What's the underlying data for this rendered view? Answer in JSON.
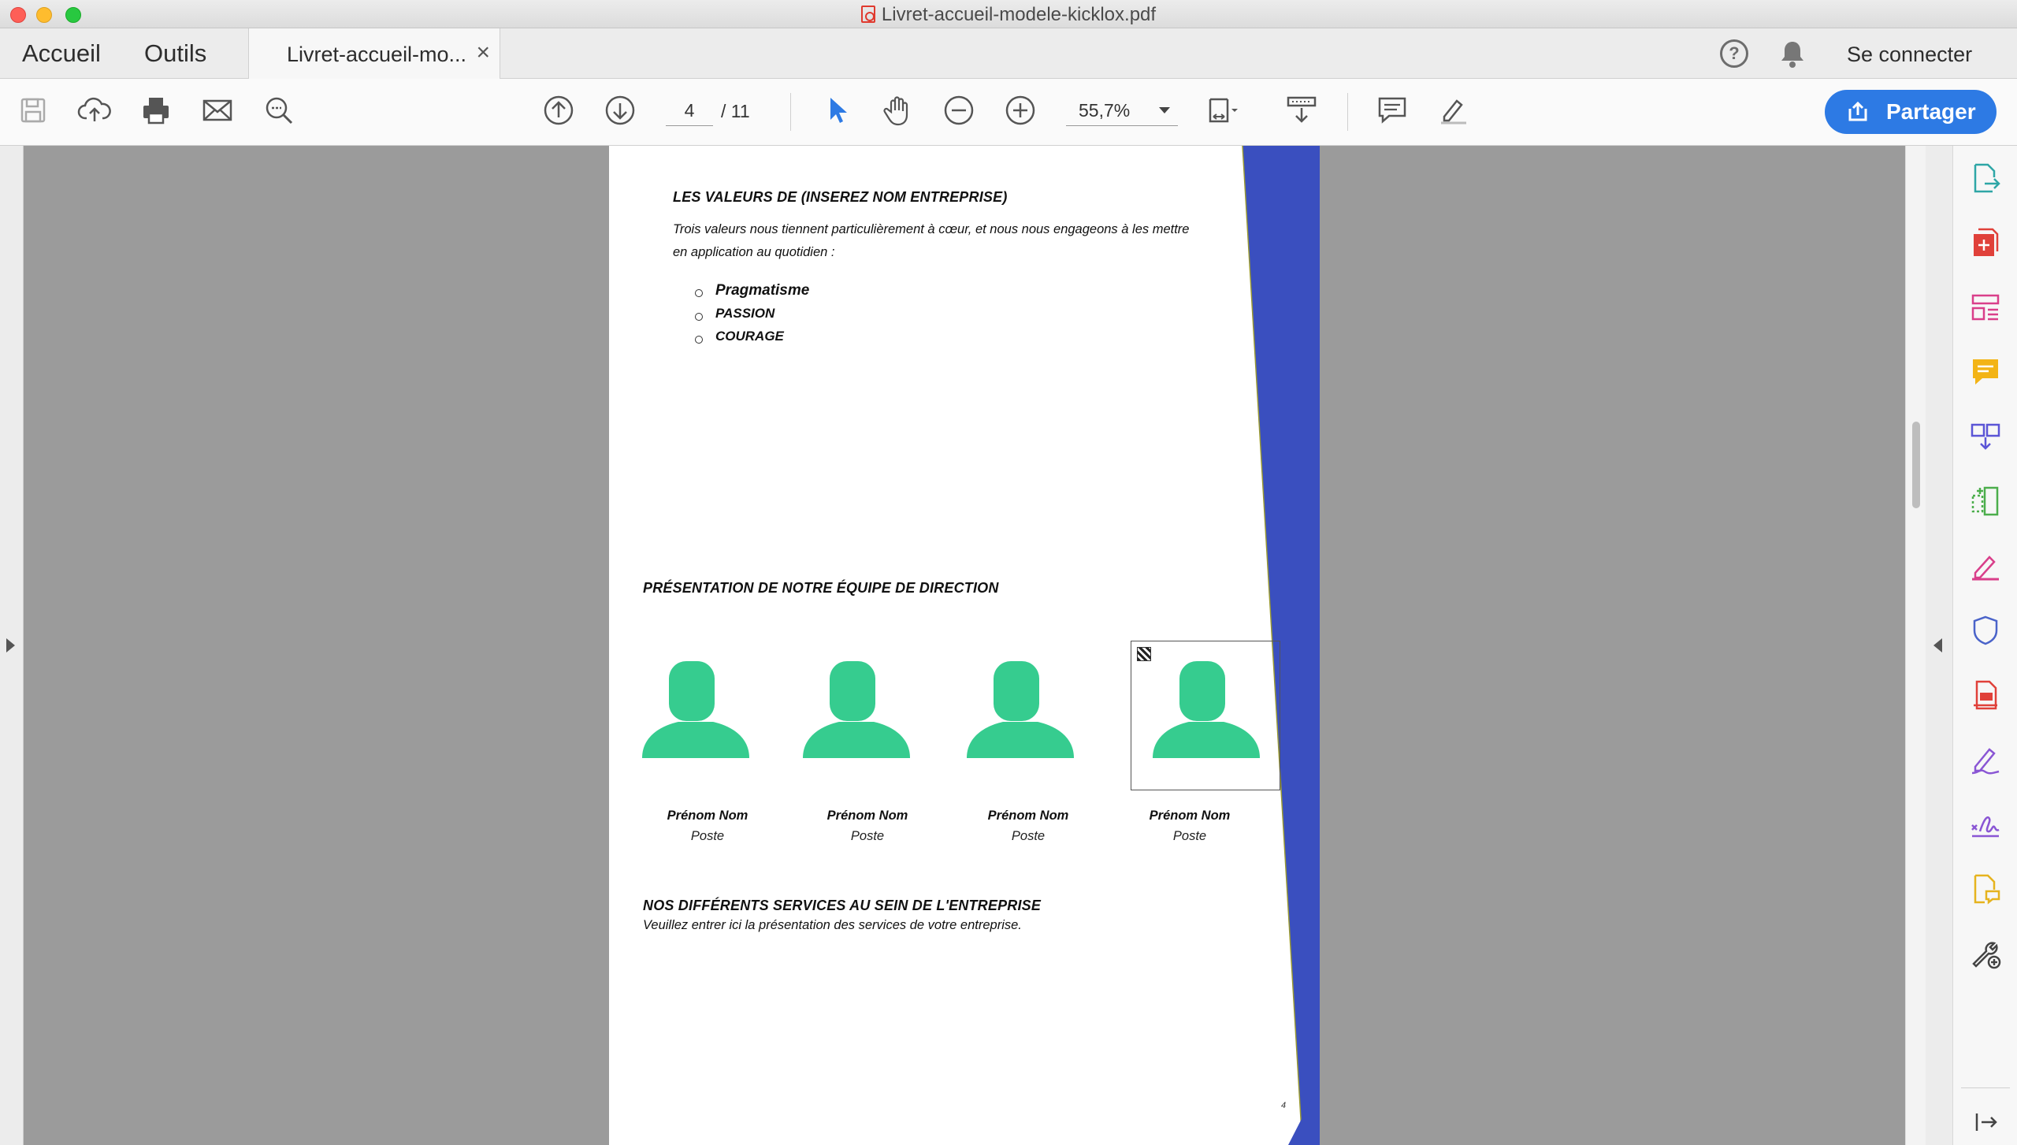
{
  "window": {
    "title": "Livret-accueil-modele-kicklox.pdf"
  },
  "nav": {
    "home": "Accueil",
    "tools": "Outils"
  },
  "tab": {
    "label": "Livret-accueil-mo...",
    "close": "×"
  },
  "header": {
    "help": "?",
    "signin": "Se connecter"
  },
  "toolbar": {
    "page_current": "4",
    "page_total": "/  11",
    "zoom": "55,7%",
    "share_label": "Partager",
    "icons": [
      "save-icon",
      "cloud-upload-icon",
      "print-icon",
      "mail-icon",
      "search-zoom-icon",
      "previous-page-icon",
      "next-page-icon",
      "select-cursor-icon",
      "hand-icon",
      "zoom-out-icon",
      "zoom-in-icon",
      "page-fit-icon",
      "scroll-mode-icon",
      "comment-icon",
      "highlight-icon"
    ]
  },
  "right_panel": {
    "tools": [
      "export-pdf-icon",
      "create-pdf-icon",
      "organize-pages-icon",
      "comment-tool-icon",
      "combine-files-icon",
      "compress-icon",
      "edit-pdf-icon",
      "protect-icon",
      "prepare-form-icon",
      "fill-sign-icon",
      "request-signature-icon",
      "send-for-comments-icon",
      "more-tools-icon",
      "collapse-panel-icon"
    ]
  },
  "document": {
    "values_heading": "LES VALEURS DE (INSEREZ NOM ENTREPRISE)",
    "values_intro_line1": "Trois valeurs nous tiennent particulièrement à cœur, et nous nous engageons à les mettre",
    "values_intro_line2": "en application au quotidien :",
    "values": [
      "Pragmatisme",
      "PASSION",
      "COURAGE"
    ],
    "team_heading": "PRÉSENTATION DE NOTRE ÉQUIPE DE DIRECTION",
    "team": [
      {
        "name": "Prénom Nom",
        "role": "Poste"
      },
      {
        "name": "Prénom Nom",
        "role": "Poste"
      },
      {
        "name": "Prénom Nom",
        "role": "Poste"
      },
      {
        "name": "Prénom Nom",
        "role": "Poste"
      }
    ],
    "services_heading": "NOS DIFFÉRENTS SERVICES AU SEIN DE L'ENTREPRISE",
    "services_text": "Veuillez entrer ici la présentation des services de votre entreprise.",
    "page_number": "4"
  },
  "colors": {
    "accent": "#2d7ae4",
    "band_blue": "#3a4fbf",
    "avatar_green": "#36cc8f"
  }
}
